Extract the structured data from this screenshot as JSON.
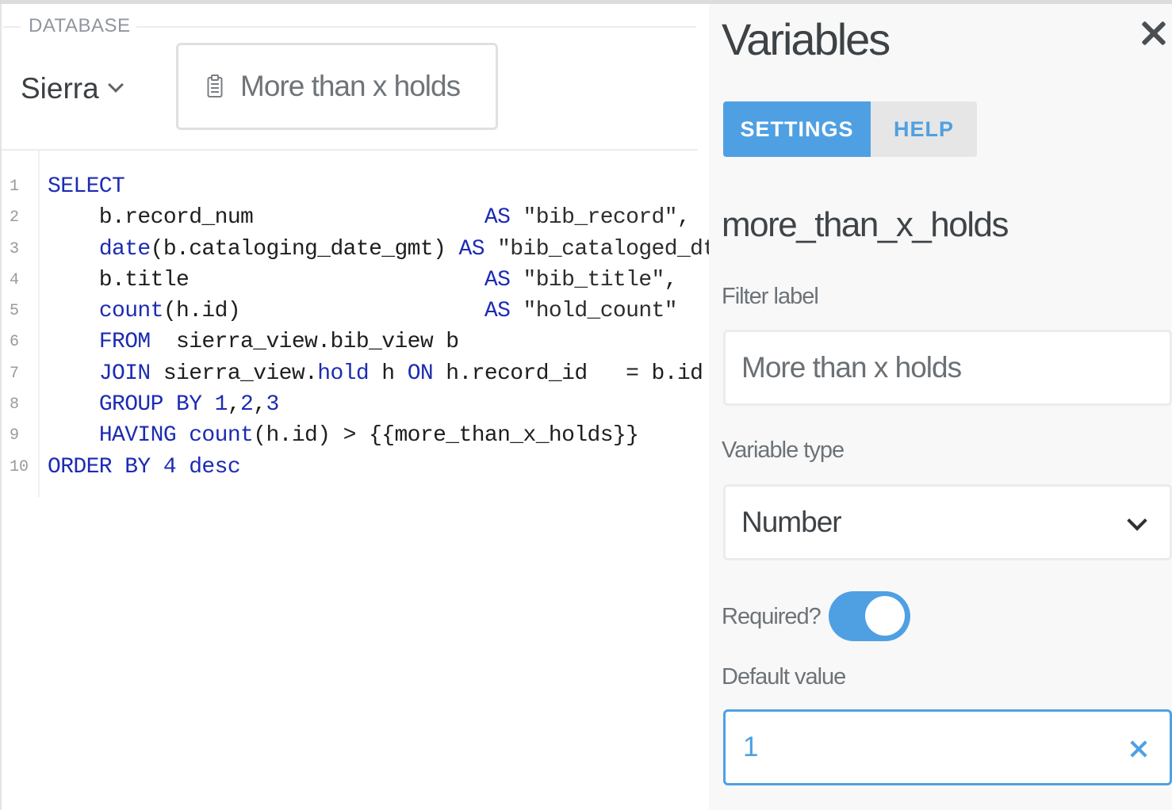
{
  "database": {
    "label": "DATABASE",
    "selected": "Sierra"
  },
  "variable_widget": {
    "placeholder": "More than x holds"
  },
  "editor": {
    "line_numbers": [
      "1",
      "2",
      "3",
      "4",
      "5",
      "6",
      "7",
      "8",
      "9",
      "10"
    ],
    "lines": [
      "SELECT",
      "    b.record_num                  AS \"bib_record\",",
      "    date(b.cataloging_date_gmt) AS \"bib_cataloged_dt\",",
      "    b.title                       AS \"bib_title\",",
      "    count(h.id)                   AS \"hold_count\"",
      "    FROM  sierra_view.bib_view b",
      "    JOIN sierra_view.hold h ON h.record_id   = b.id",
      "    GROUP BY 1,2,3",
      "    HAVING count(h.id) > {{more_than_x_holds}}",
      "ORDER BY 4 desc"
    ]
  },
  "panel": {
    "title": "Variables",
    "tabs": {
      "settings": "SETTINGS",
      "help": "HELP"
    },
    "variable_name": "more_than_x_holds",
    "filter_label": {
      "label": "Filter label",
      "value": "More than x holds"
    },
    "variable_type": {
      "label": "Variable type",
      "value": "Number"
    },
    "required": {
      "label": "Required?",
      "on": true
    },
    "default_value": {
      "label": "Default value",
      "value": "1"
    }
  },
  "colors": {
    "accent": "#4fa0e2",
    "keyword": "#1c2bb3",
    "panel_bg": "#f8f8f8"
  }
}
